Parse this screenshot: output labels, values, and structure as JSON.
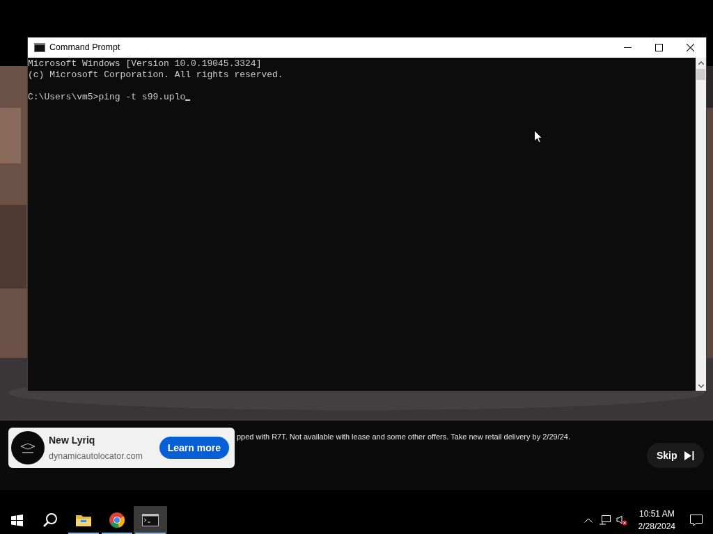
{
  "window": {
    "title": "Command Prompt",
    "header_lines": [
      "Microsoft Windows [Version 10.0.19045.3324]",
      "(c) Microsoft Corporation. All rights reserved."
    ],
    "prompt": "C:\\Users\\vm5>ping -t s99.uplo"
  },
  "ad": {
    "title": "New Lyriq",
    "domain": "dynamicautolocator.com",
    "button": "Learn more",
    "disclaimer": "pped with R7T. Not available with lease and some other offers. Take new retail delivery by 2/29/24.",
    "skip": "Skip"
  },
  "taskbar": {
    "items": [
      {
        "kind": "start",
        "selected": false,
        "running": false
      },
      {
        "kind": "search",
        "selected": false,
        "running": false
      },
      {
        "kind": "explorer",
        "selected": false,
        "running": true
      },
      {
        "kind": "chrome",
        "selected": false,
        "running": true
      },
      {
        "kind": "terminal",
        "selected": true,
        "running": true
      }
    ],
    "time": "10:51 AM",
    "date": "2/28/2024"
  }
}
